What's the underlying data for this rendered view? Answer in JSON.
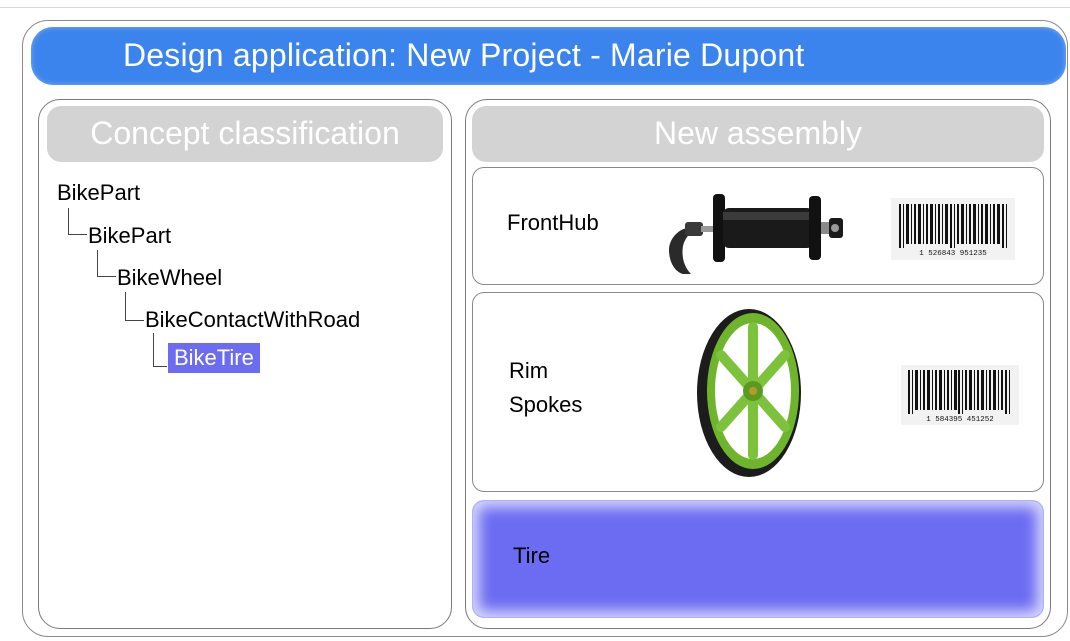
{
  "window": {
    "title": "Design application: New Project - Marie Dupont"
  },
  "concept_panel": {
    "header": "Concept classification",
    "tree": [
      {
        "label": "BikePart",
        "depth": 0
      },
      {
        "label": "BikePart",
        "depth": 1
      },
      {
        "label": "BikeWheel",
        "depth": 2
      },
      {
        "label": "BikeContactWithRoad",
        "depth": 3
      },
      {
        "label": "BikeTire",
        "depth": 4,
        "selected": true
      }
    ]
  },
  "assembly_panel": {
    "header": "New assembly",
    "items": [
      {
        "label": "FrontHub",
        "image": "front-hub-image",
        "barcode_digits": "1 526843 951235"
      },
      {
        "label_line1": "Rim",
        "label_line2": "Spokes",
        "image": "green-wheel-image",
        "barcode_digits": "1 584395 451252"
      },
      {
        "label": "Tire",
        "selected": true
      }
    ]
  },
  "colors": {
    "title_bar": "#3b84ee",
    "header_gray": "#d3d3d3",
    "selection": "#6c6cf2"
  }
}
